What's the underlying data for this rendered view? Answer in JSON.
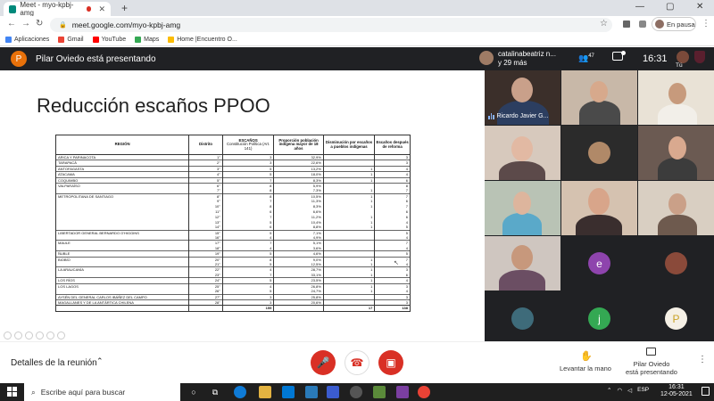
{
  "browser": {
    "tab_title": "Meet - myo-kpbj-amg",
    "url": "meet.google.com/myo-kpbj-amg",
    "profile_status": "En pausa",
    "new_tab": "+",
    "win_min": "—",
    "win_max": "▢",
    "win_close": "✕",
    "back": "←",
    "forward": "→",
    "reload": "↻",
    "lock": "🔒",
    "star": "☆",
    "menu": "⋮",
    "bookmarks": [
      {
        "label": "Aplicaciones",
        "color": "#4285f4"
      },
      {
        "label": "Gmail",
        "color": "#ea4335"
      },
      {
        "label": "YouTube",
        "color": "#ff0000"
      },
      {
        "label": "Maps",
        "color": "#34a853"
      },
      {
        "label": "Home |Encuentro O...",
        "color": "#fbbc04"
      }
    ]
  },
  "meet_header": {
    "presenter_initial": "P",
    "presenting_text": "Pilar Oviedo está presentando",
    "pinned_name_line1": "catalinabeatriz n...",
    "pinned_name_line2": "y 29 más",
    "people_count": "47",
    "clock": "16:31",
    "self_label": "Tú"
  },
  "slide": {
    "title": "Reducción escaños PPOO",
    "headers": {
      "region": "REGIÓN",
      "district": "Distrito",
      "seats": "ESCAÑOS",
      "seats_sub": "Constitución Política (Art. 141)",
      "proportion": "Proporción población indígena mayor de 18 años",
      "reduction": "Disminución por escaños a pueblos indígenas",
      "after": "Escaños después de reforma"
    },
    "rows": [
      {
        "region": "ARICA Y PARINACOTA",
        "district": "1°",
        "seats": "3",
        "pct": "32,9%",
        "red": "",
        "after": "3",
        "sep": true
      },
      {
        "region": "TARAPACÁ",
        "district": "2°",
        "seats": "3",
        "pct": "22,6%",
        "red": "",
        "after": "3",
        "sep": true
      },
      {
        "region": "ANTOFAGASTA",
        "district": "3°",
        "seats": "5",
        "pct": "13,2%",
        "red": "1",
        "after": "4",
        "sep": true
      },
      {
        "region": "ATACAMA",
        "district": "4°",
        "seats": "5",
        "pct": "18,0%",
        "red": "1",
        "after": "4",
        "sep": true
      },
      {
        "region": "COQUIMBO",
        "district": "5°",
        "seats": "7",
        "pct": "8,3%",
        "red": "1",
        "after": "6",
        "sep": true
      },
      {
        "region": "VALPARAÍSO",
        "district": "6°",
        "seats": "8",
        "pct": "5,9%",
        "red": "",
        "after": "8",
        "sep": true
      },
      {
        "region": "",
        "district": "7°",
        "seats": "8",
        "pct": "7,3%",
        "red": "1",
        "after": "7",
        "sep": false
      },
      {
        "region": "METROPOLITANA DE SANTIAGO",
        "district": "8°",
        "seats": "8",
        "pct": "10,5%",
        "red": "1",
        "after": "7",
        "sep": true
      },
      {
        "region": "",
        "district": "9°",
        "seats": "7",
        "pct": "11,3%",
        "red": "1",
        "after": "6",
        "sep": false
      },
      {
        "region": "",
        "district": "10°",
        "seats": "8",
        "pct": "8,3%",
        "red": "1",
        "after": "7",
        "sep": false
      },
      {
        "region": "",
        "district": "11°",
        "seats": "6",
        "pct": "6,6%",
        "red": "",
        "after": "6",
        "sep": false
      },
      {
        "region": "",
        "district": "12°",
        "seats": "7",
        "pct": "11,2%",
        "red": "1",
        "after": "6",
        "sep": false
      },
      {
        "region": "",
        "district": "13°",
        "seats": "5",
        "pct": "10,4%",
        "red": "1",
        "after": "4",
        "sep": false
      },
      {
        "region": "",
        "district": "14°",
        "seats": "6",
        "pct": "8,8%",
        "red": "1",
        "after": "5",
        "sep": false
      },
      {
        "region": "LIBERTADOR GENERAL BERNARDO O'HIGGINS",
        "district": "15°",
        "seats": "5",
        "pct": "7,1%",
        "red": "",
        "after": "5",
        "sep": true
      },
      {
        "region": "",
        "district": "16°",
        "seats": "4",
        "pct": "4,9%",
        "red": "",
        "after": "4",
        "sep": false
      },
      {
        "region": "MAULE",
        "district": "17°",
        "seats": "7",
        "pct": "5,1%",
        "red": "",
        "after": "7",
        "sep": true
      },
      {
        "region": "",
        "district": "18°",
        "seats": "4",
        "pct": "3,6%",
        "red": "",
        "after": "4",
        "sep": false
      },
      {
        "region": "ÑUBLE",
        "district": "19°",
        "seats": "5",
        "pct": "4,6%",
        "red": "",
        "after": "5",
        "sep": true
      },
      {
        "region": "BIOBÍO",
        "district": "20°",
        "seats": "8",
        "pct": "9,0%",
        "red": "1",
        "after": "7",
        "sep": true
      },
      {
        "region": "",
        "district": "21°",
        "seats": "5",
        "pct": "12,5%",
        "red": "1",
        "after": "4",
        "sep": false
      },
      {
        "region": "LA ARAUCANÍA",
        "district": "22°",
        "seats": "4",
        "pct": "28,7%",
        "red": "1",
        "after": "3",
        "sep": true
      },
      {
        "region": "",
        "district": "23°",
        "seats": "7",
        "pct": "33,1%",
        "red": "1",
        "after": "6",
        "sep": false
      },
      {
        "region": "LOS RÍOS",
        "district": "24°",
        "seats": "5",
        "pct": "23,5%",
        "red": "1",
        "after": "4",
        "sep": true
      },
      {
        "region": "LOS LAGOS",
        "district": "25°",
        "seats": "4",
        "pct": "26,8%",
        "red": "1",
        "after": "3",
        "sep": true
      },
      {
        "region": "",
        "district": "26°",
        "seats": "5",
        "pct": "24,7%",
        "red": "1",
        "after": "4",
        "sep": false
      },
      {
        "region": "AYSÉN DEL GENERAL CARLOS IBÁÑEZ DEL CAMPO",
        "district": "27°",
        "seats": "3",
        "pct": "25,8%",
        "red": "",
        "after": "3",
        "sep": true
      },
      {
        "region": "MAGALLANES Y DE LA ANTÁRTICA CHILENA",
        "district": "28°",
        "seats": "3",
        "pct": "20,6%",
        "red": "",
        "after": "3",
        "sep": true
      }
    ],
    "totals": {
      "seats": "155",
      "reduction": "17",
      "after": "138"
    }
  },
  "tiles": {
    "speaker_name": "Ricardo Javier G...",
    "initial_e": "e",
    "initial_j": "j",
    "initial_p": "P",
    "color_e": "#8e44ad",
    "color_j": "#34a853"
  },
  "bottom": {
    "details": "Detalles de la reunión",
    "chevron": "⌃",
    "raise_hand": "Levantar la mano",
    "present_line1": "Pilar Oviedo",
    "present_line2": "está presentando",
    "more": "⋮"
  },
  "taskbar": {
    "search_placeholder": "Escribe aquí para buscar",
    "lang": "ESP",
    "time": "16:31",
    "date": "12-05-2021"
  }
}
